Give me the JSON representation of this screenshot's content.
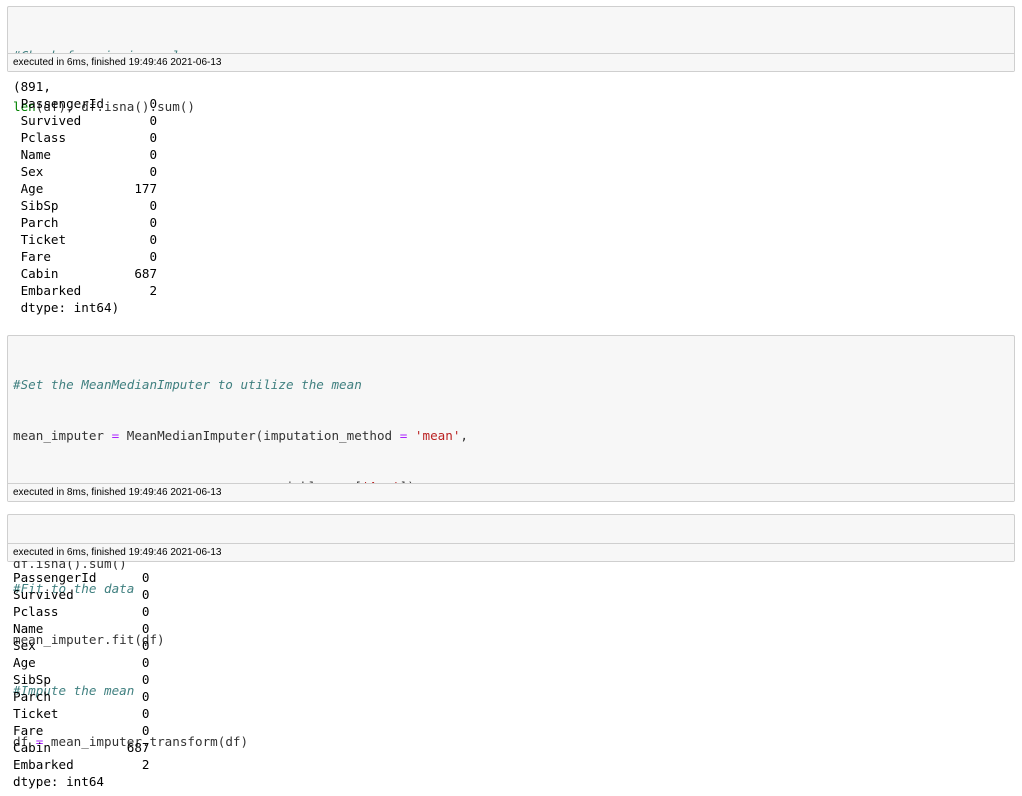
{
  "cells": [
    {
      "code": {
        "comment": "#Check for missing values",
        "builtin": "len",
        "rest": "(df), df.isna().sum()"
      },
      "exec_status": "executed in 6ms, finished 19:49:46 2021-06-13",
      "output": [
        "(891,",
        " PassengerId      0",
        " Survived         0",
        " Pclass           0",
        " Name             0",
        " Sex              0",
        " Age            177",
        " SibSp            0",
        " Parch            0",
        " Ticket           0",
        " Fare             0",
        " Cabin          687",
        " Embarked         2",
        " dtype: int64)"
      ]
    },
    {
      "code": {
        "comment1": "#Set the MeanMedianImputer to utilize the mean",
        "l2_a": "mean_imputer ",
        "l2_eq": "=",
        "l2_b": " MeanMedianImputer(imputation_method ",
        "l2_eq2": "=",
        "l2_c": " ",
        "l2_str": "'mean'",
        "l2_d": ",",
        "l3_a": "                                 variables ",
        "l3_eq": "=",
        "l3_b": " [",
        "l3_str": "'Age'",
        "l3_c": "])",
        "comment2": "#Fit to the data",
        "l6": "mean_imputer.fit(df)",
        "comment3": "#Impute the mean",
        "l8_a": "df ",
        "l8_eq": "=",
        "l8_b": " mean_imputer.transform(df)"
      },
      "exec_status": "executed in 8ms, finished 19:49:46 2021-06-13"
    },
    {
      "code": {
        "line": "df.isna().sum()"
      },
      "exec_status": "executed in 6ms, finished 19:49:46 2021-06-13",
      "output": [
        "PassengerId      0",
        "Survived         0",
        "Pclass           0",
        "Name             0",
        "Sex              0",
        "Age              0",
        "SibSp            0",
        "Parch            0",
        "Ticket           0",
        "Fare             0",
        "Cabin          687",
        "Embarked         2",
        "dtype: int64"
      ]
    }
  ]
}
